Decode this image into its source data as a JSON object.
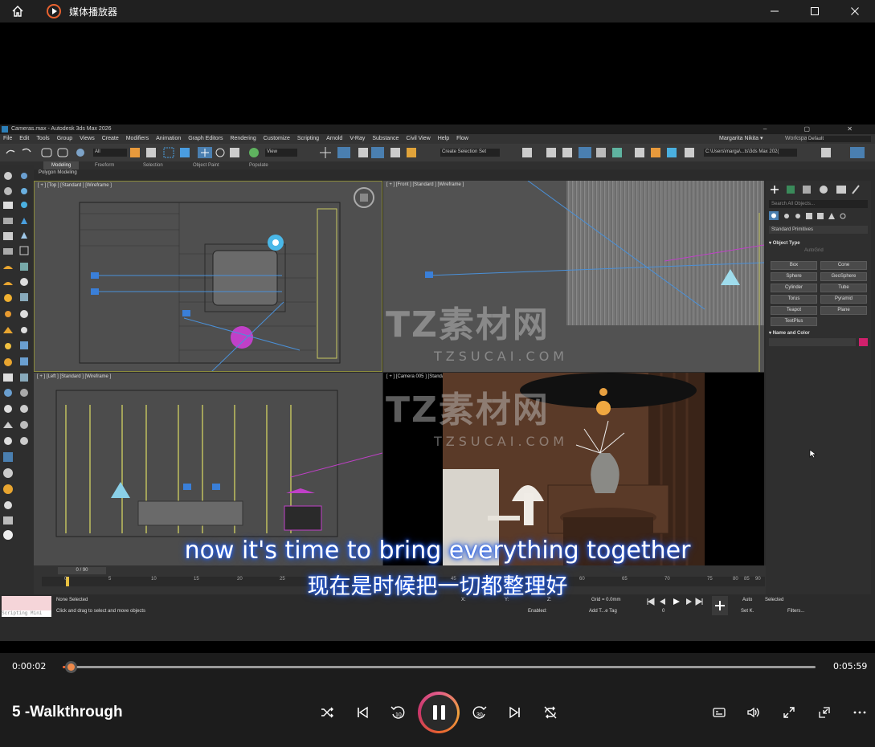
{
  "titlebar": {
    "app_title": "媒体播放器",
    "icons": [
      "home-icon",
      "media-player-logo-icon",
      "minimize-icon",
      "maximize-icon",
      "close-icon"
    ]
  },
  "max_window": {
    "title": "Cameras.max - Autodesk 3ds Max 2026",
    "menu": [
      "File",
      "Edit",
      "Tools",
      "Group",
      "Views",
      "Create",
      "Modifiers",
      "Animation",
      "Graph Editors",
      "Rendering",
      "Customize",
      "Scripting",
      "Arnold",
      "V-Ray",
      "Substance",
      "Civil View",
      "Help",
      "Flow"
    ],
    "user": "Margarita Nikita ▾",
    "workspaces_label": "Workspaces:",
    "workspace_value": "Default",
    "filter_all": "All",
    "view_dd": "View",
    "selection_set": "Create Selection Set",
    "path": "C:\\Users\\marga\\...ts\\3ds Max 202(",
    "ribbon_tabs": [
      "Modeling",
      "Freeform",
      "Selection",
      "Object Paint",
      "Populate"
    ],
    "ribbon_sub": "Polygon Modeling",
    "viewports": {
      "top": "[ + ] [Top ] [Standard ] [Wireframe ]",
      "front": "[ + ] [Front ] [Standard ] [Wireframe ]",
      "left": "[ + ] [Left ] [Standard ] [Wireframe ]",
      "camera": "[ + ] [Camera 005 ] [Standard ] [Default Shading ]"
    },
    "command_panel": {
      "search_placeholder": "Search All Objects...",
      "category": "Standard Primitives",
      "object_type": "Object Type",
      "autogrid": "AutoGrid",
      "primitives": [
        "Box",
        "Cone",
        "Sphere",
        "GeoSphere",
        "Cylinder",
        "Tube",
        "Torus",
        "Pyramid",
        "Teapot",
        "Plane",
        "TextPlus"
      ],
      "name_and_color": "Name and Color"
    },
    "timeline": {
      "frame_label": "0 / 90",
      "ticks": [
        "0",
        "5",
        "10",
        "15",
        "20",
        "25",
        "30",
        "35",
        "40",
        "45",
        "50",
        "55",
        "60",
        "65",
        "70",
        "75",
        "80",
        "85",
        "90"
      ]
    },
    "status": {
      "scripting": "Scripting Mini",
      "selection": "None Selected",
      "prompt": "Click and drag to select and move objects",
      "x": "X:",
      "y": "Y:",
      "z": "Z:",
      "grid": "Grid = 0.0mm",
      "enabled": "Enabled:",
      "add_time_tag": "Add T...e Tag",
      "auto": "Auto",
      "set_key": "Set K.",
      "selected": "Selected",
      "filters": "Filters...",
      "frame": "0"
    }
  },
  "watermark": {
    "cn": "TZ素材网",
    "en": "TZSUCAI.COM"
  },
  "subtitles": {
    "en": "now it's time to bring everything together",
    "zh": "现在是时候把一切都整理好"
  },
  "player": {
    "current_time": "0:00:02",
    "total_time": "0:05:59",
    "progress": 0.0106,
    "video_title": "5 -Walkthrough",
    "accent": "#e9622f",
    "controls": [
      "shuffle-icon",
      "previous-icon",
      "rewind-10-icon",
      "pause-icon",
      "forward-30-icon",
      "next-icon",
      "repeat-off-icon",
      "captions-icon",
      "volume-icon",
      "fullscreen-icon",
      "mini-player-icon",
      "more-icon"
    ],
    "rewind_label": "10",
    "forward_label": "30"
  }
}
